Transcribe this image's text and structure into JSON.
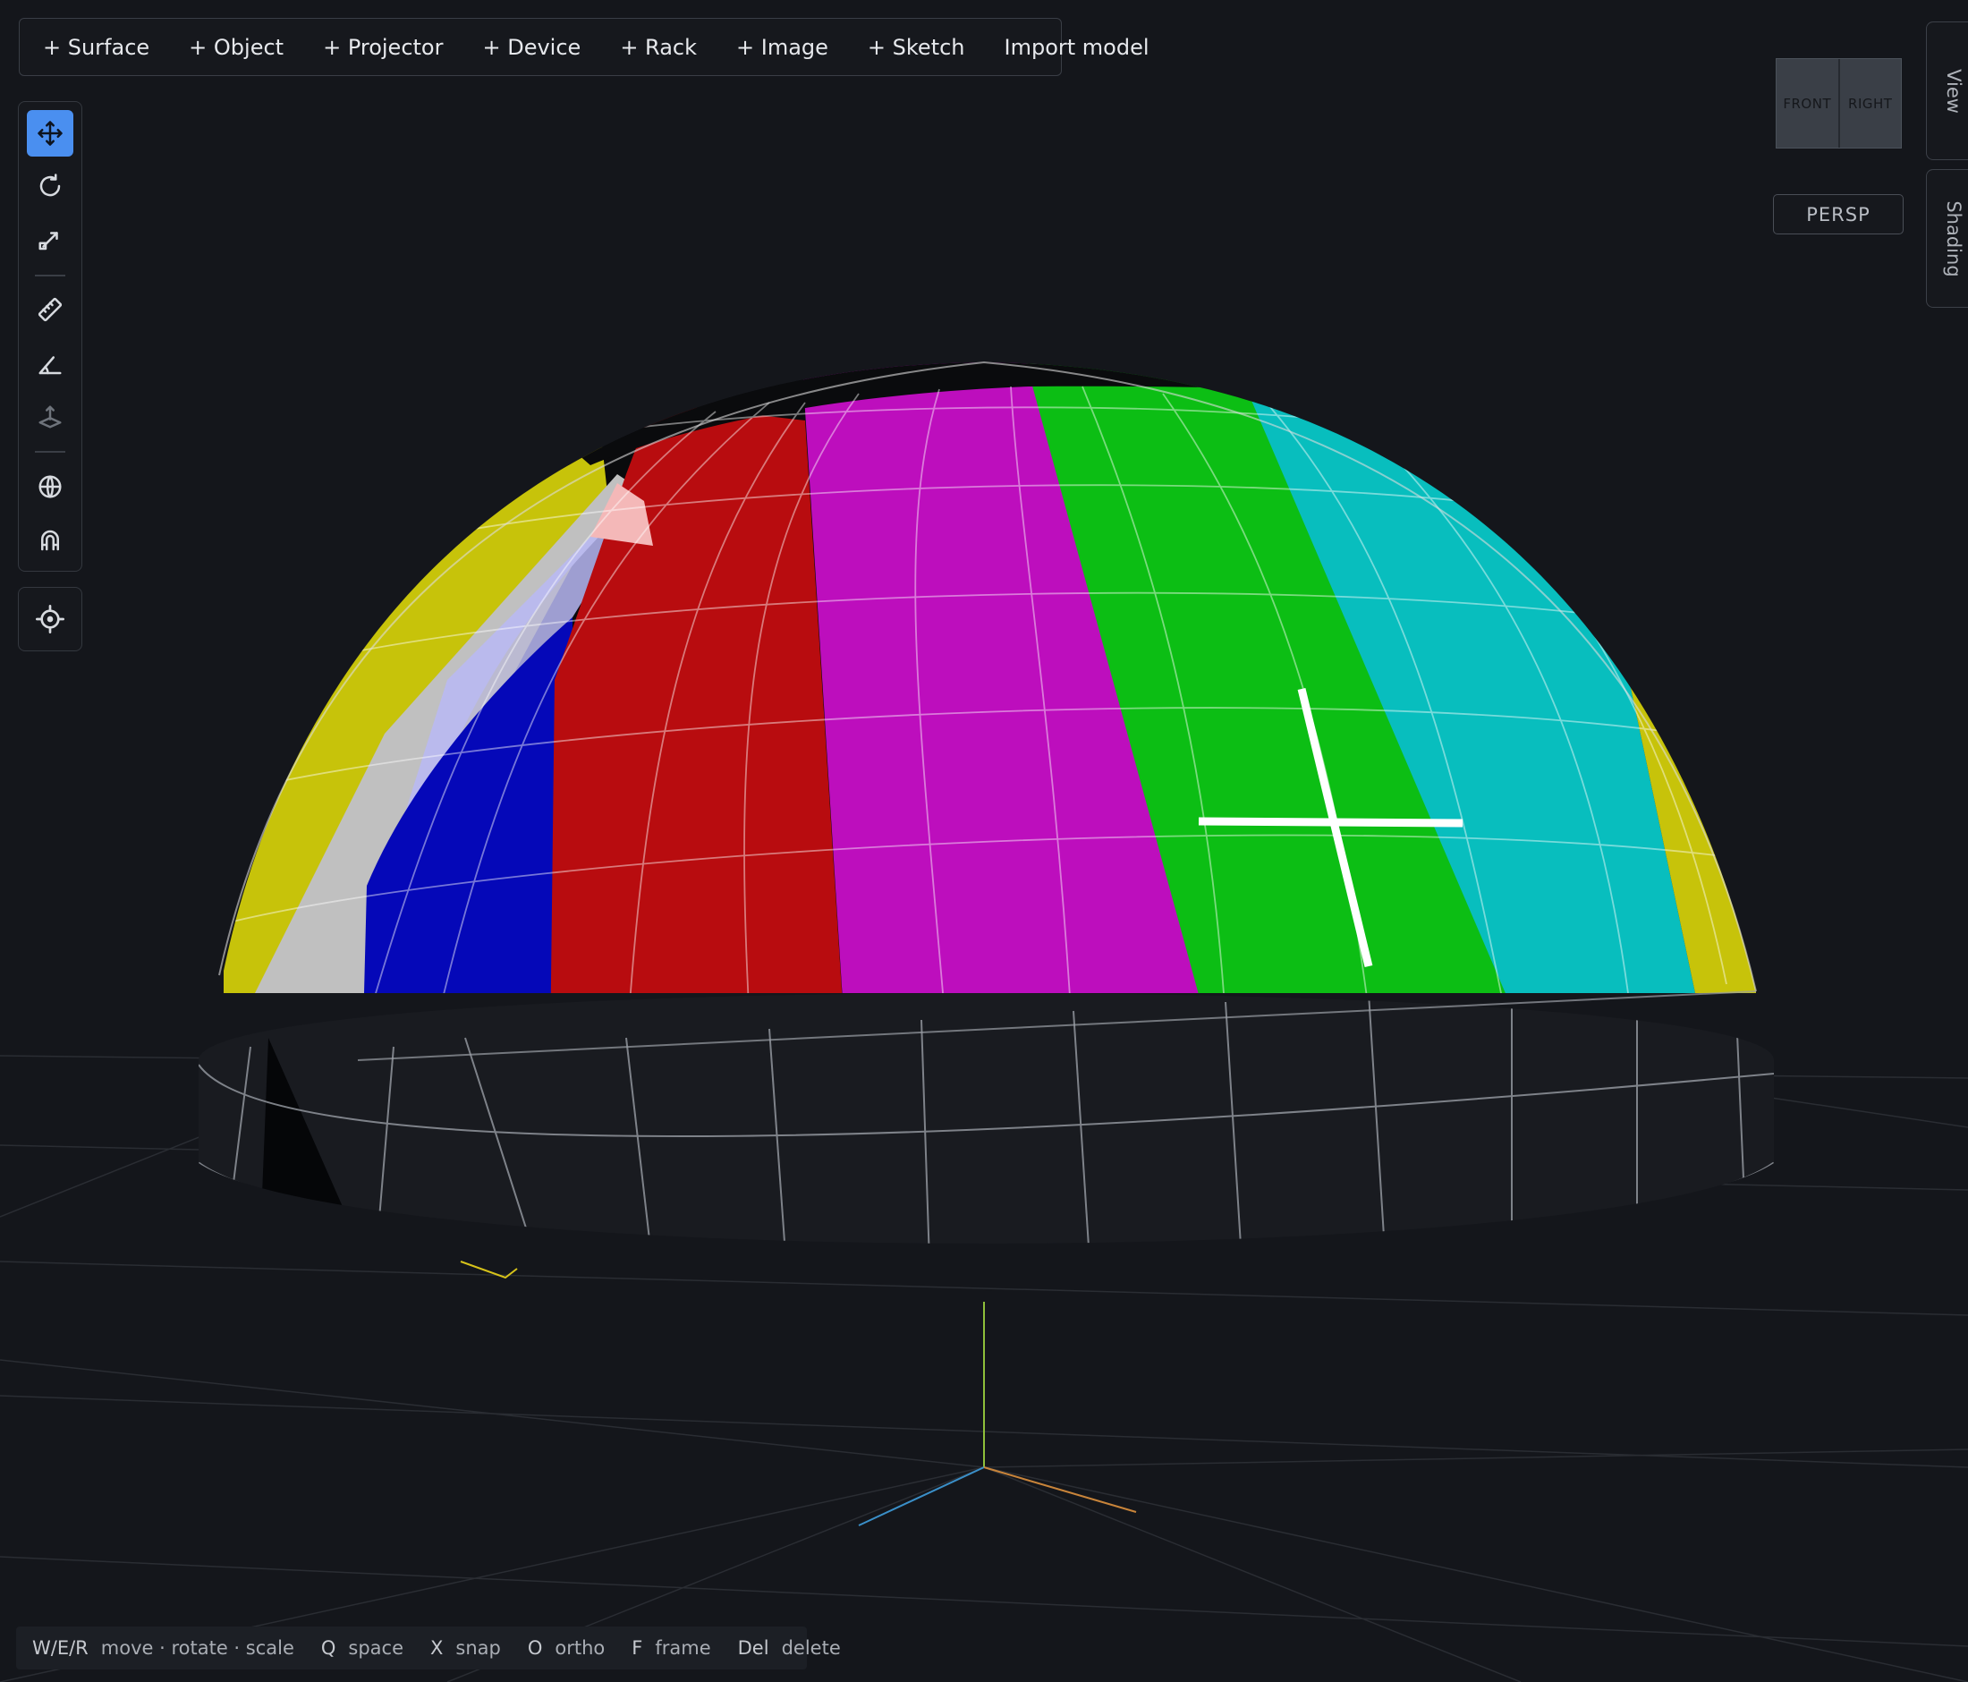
{
  "toolbar": {
    "add_surface": "+ Surface",
    "add_object": "+ Object",
    "add_projector": "+ Projector",
    "add_device": "+ Device",
    "add_rack": "+ Rack",
    "add_image": "+ Image",
    "add_sketch": "+ Sketch",
    "import_model": "Import model"
  },
  "tools": {
    "icons": [
      "move-icon",
      "rotate-icon",
      "scale-icon",
      "ruler-icon",
      "angle-icon",
      "elevation-icon",
      "globe-icon",
      "magnet-icon",
      "target-icon"
    ],
    "active": "move",
    "accent": "#4a8ff0"
  },
  "viewcube": {
    "front": "FRONT",
    "right": "RIGHT"
  },
  "camera": {
    "projection": "PERSP"
  },
  "side_tabs": {
    "view": "View",
    "shading": "Shading"
  },
  "hints": [
    {
      "key": "W/E/R",
      "desc": "move · rotate · scale"
    },
    {
      "key": "Q",
      "desc": "space"
    },
    {
      "key": "X",
      "desc": "snap"
    },
    {
      "key": "O",
      "desc": "ortho"
    },
    {
      "key": "F",
      "desc": "frame"
    },
    {
      "key": "Del",
      "desc": "delete"
    }
  ],
  "test_pattern_colors": [
    "#c7c30a",
    "#c0c0c0",
    "#0508b8",
    "#b80c0f",
    "#bd0ebd",
    "#0cbe14",
    "#08bebe"
  ]
}
